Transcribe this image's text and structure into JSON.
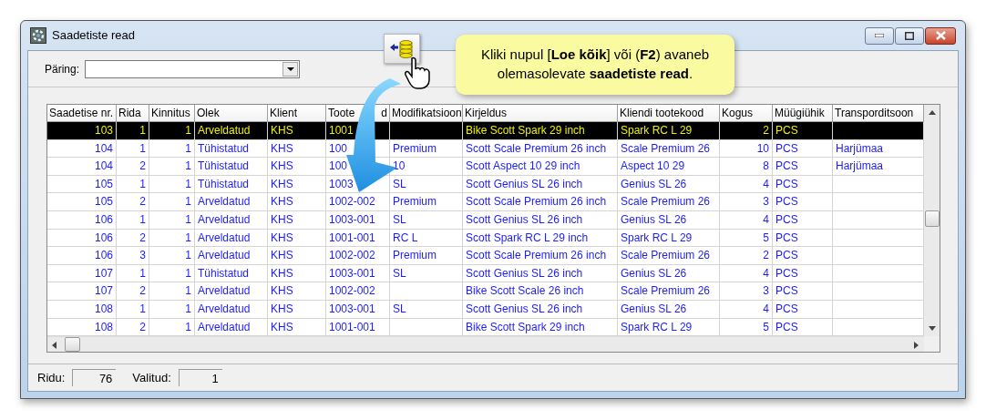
{
  "window": {
    "title": "Saadetiste read"
  },
  "query": {
    "label": "Päring:"
  },
  "tooltip": {
    "text": "Kliki nupul [**Loe kõik**] või (**F2**) avaneb\nolemasolevate **saadetiste read**."
  },
  "table": {
    "columns": [
      {
        "label": "Saadetise nr."
      },
      {
        "label": "Rida"
      },
      {
        "label": "Kinnitus"
      },
      {
        "label": "Olek"
      },
      {
        "label": "Klient"
      },
      {
        "label": "Toote",
        "label_end": "d"
      },
      {
        "label": "Modifikatsioon"
      },
      {
        "label": "Kirjeldus"
      },
      {
        "label": "Kliendi tootekood"
      },
      {
        "label": "Kogus"
      },
      {
        "label": "Müügiühik"
      },
      {
        "label": "Transporditsoon"
      }
    ],
    "rows": [
      {
        "selected": true,
        "cells": [
          "103",
          "1",
          "1",
          "Arveldatud",
          "KHS",
          "1001",
          null,
          "Bike Scott Spark 29 inch",
          "Spark RC L 29",
          "2",
          "PCS",
          null
        ]
      },
      {
        "selected": false,
        "cells": [
          "104",
          "1",
          "1",
          "Tühistatud",
          "KHS",
          "100",
          "Premium",
          "Scott Scale Premium 26 inch",
          "Scale Premium 26",
          "10",
          "PCS",
          "Harjümaa"
        ]
      },
      {
        "selected": false,
        "cells": [
          "104",
          "2",
          "1",
          "Tühistatud",
          "KHS",
          "100",
          "10",
          "Scott Aspect 10 29 inch",
          "Aspect 10 29",
          "8",
          "PCS",
          "Harjümaa"
        ]
      },
      {
        "selected": false,
        "cells": [
          "105",
          "1",
          "1",
          "Tühistatud",
          "KHS",
          "1003",
          "SL",
          "Scott Genius SL 26 inch",
          "Genius SL 26",
          "4",
          "PCS",
          null
        ]
      },
      {
        "selected": false,
        "cells": [
          "105",
          "2",
          "1",
          "Arveldatud",
          "KHS",
          "1002-002",
          "Premium",
          "Scott Scale Premium 26 inch",
          "Scale Premium 26",
          "3",
          "PCS",
          null
        ]
      },
      {
        "selected": false,
        "cells": [
          "106",
          "1",
          "1",
          "Arveldatud",
          "KHS",
          "1003-001",
          "SL",
          "Scott Genius SL 26 inch",
          "Genius SL 26",
          "4",
          "PCS",
          null
        ]
      },
      {
        "selected": false,
        "cells": [
          "106",
          "2",
          "1",
          "Arveldatud",
          "KHS",
          "1001-001",
          "RC L",
          "Scott Spark RC L 29 inch",
          "Spark RC L 29",
          "5",
          "PCS",
          null
        ]
      },
      {
        "selected": false,
        "cells": [
          "106",
          "3",
          "1",
          "Arveldatud",
          "KHS",
          "1002-002",
          "Premium",
          "Scott Scale Premium 26 inch",
          "Scale Premium 26",
          "2",
          "PCS",
          null
        ]
      },
      {
        "selected": false,
        "cells": [
          "107",
          "1",
          "1",
          "Tühistatud",
          "KHS",
          "1003-001",
          "SL",
          "Scott Genius SL 26 inch",
          "Genius SL 26",
          "4",
          "PCS",
          null
        ]
      },
      {
        "selected": false,
        "cells": [
          "107",
          "2",
          "1",
          "Arveldatud",
          "KHS",
          "1002-002",
          null,
          "Bike Scott Scale 26 inch",
          "Scale Premium 26",
          "3",
          "PCS",
          null
        ]
      },
      {
        "selected": false,
        "cells": [
          "108",
          "1",
          "1",
          "Arveldatud",
          "KHS",
          "1003-001",
          "SL",
          "Scott Genius SL 26 inch",
          "Genius SL 26",
          "4",
          "PCS",
          null
        ]
      },
      {
        "selected": false,
        "cells": [
          "108",
          "2",
          "1",
          "Arveldatud",
          "KHS",
          "1001-001",
          null,
          "Bike Scott Spark 29 inch",
          "Spark RC L 29",
          "5",
          "PCS",
          null
        ]
      }
    ]
  },
  "status_bar": [
    {
      "label": "Ridu:",
      "value": "76"
    },
    {
      "label": "Valitud:",
      "value": "1"
    }
  ]
}
